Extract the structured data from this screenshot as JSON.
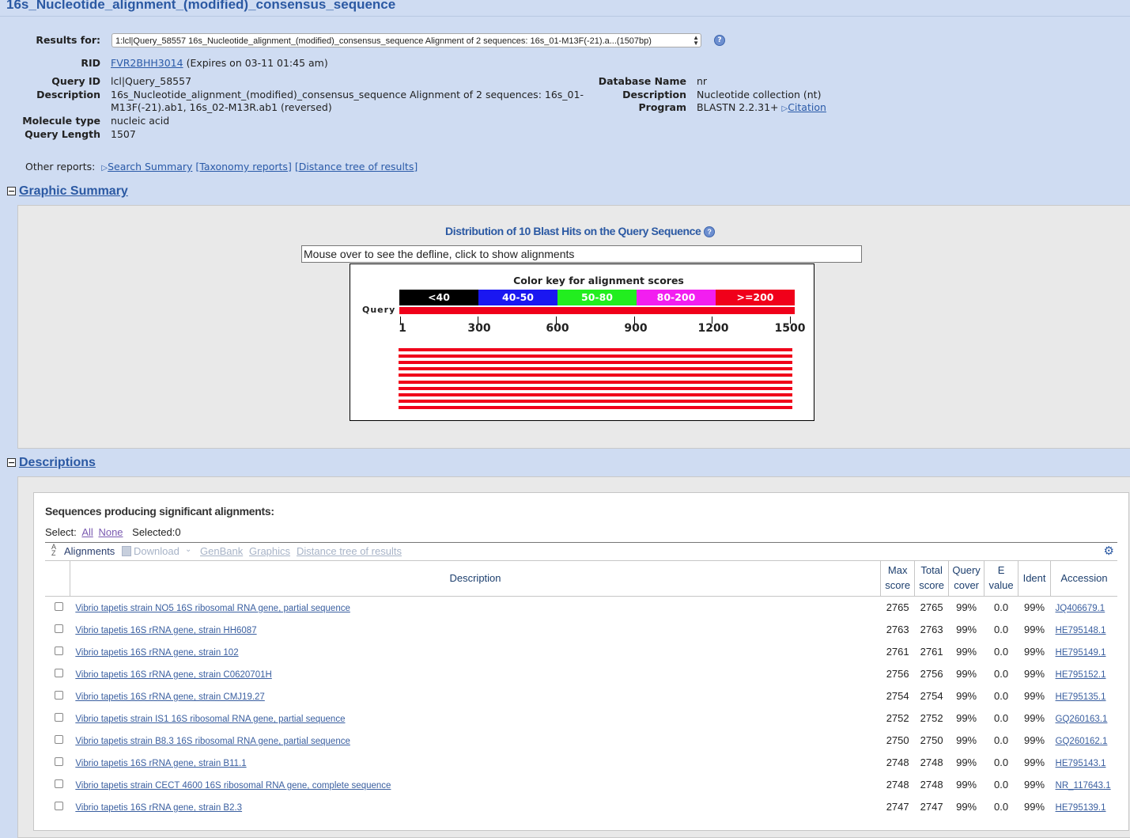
{
  "page": {
    "title": "16s_Nucleotide_alignment_(modified)_consensus_sequence"
  },
  "results_for": {
    "label": "Results for:",
    "value": "1:lcl|Query_58557 16s_Nucleotide_alignment_(modified)_consensus_sequence Alignment of 2 sequences: 16s_01-M13F(-21).a...(1507bp)"
  },
  "rid": {
    "label": "RID",
    "value": "FVR2BHH3014",
    "expires": "(Expires on 03-11 01:45 am)"
  },
  "query": {
    "id_label": "Query ID",
    "id": "lcl|Query_58557",
    "desc_label": "Description",
    "desc_line1": "16s_Nucleotide_alignment_(modified)_consensus_sequence Alignment of 2 sequences: 16s_01-",
    "desc_line2": "M13F(-21).ab1, 16s_02-M13R.ab1 (reversed)",
    "moltype_label": "Molecule type",
    "moltype": "nucleic acid",
    "length_label": "Query Length",
    "length": "1507"
  },
  "database": {
    "name_label": "Database Name",
    "name": "nr",
    "desc_label": "Description",
    "desc": "Nucleotide collection (nt)",
    "program_label": "Program",
    "program": "BLASTN 2.2.31+",
    "citation": "Citation"
  },
  "other_reports": {
    "label": "Other reports:",
    "search_summary": "Search Summary",
    "taxonomy": "[Taxonomy reports]",
    "distance_tree": "[Distance tree of results]"
  },
  "graphic_summary": {
    "heading": "Graphic Summary",
    "dist_title": "Distribution of 10 Blast Hits on the Query Sequence",
    "defline": "Mouse over to see the defline, click to show alignments",
    "color_key_title": "Color key for alignment scores",
    "query_label": "Query",
    "key": [
      {
        "label": "<40",
        "color": "#000000"
      },
      {
        "label": "40-50",
        "color": "#1a17f1"
      },
      {
        "label": "50-80",
        "color": "#22ee1f"
      },
      {
        "label": "80-200",
        "color": "#f21ef0"
      },
      {
        "label": ">=200",
        "color": "#f0001a"
      }
    ],
    "ticks": [
      "1",
      "300",
      "600",
      "900",
      "1200",
      "1500"
    ],
    "hit_count": 10
  },
  "descriptions": {
    "heading": "Descriptions",
    "panel_title": "Sequences producing significant alignments:",
    "select_label": "Select:",
    "select_all": "All",
    "select_none": "None",
    "selected": "Selected:0",
    "toolbar": {
      "alignments": "Alignments",
      "download": "Download",
      "genbank": "GenBank",
      "graphics": "Graphics",
      "distance_tree": "Distance tree of results"
    },
    "columns": {
      "description": "Description",
      "max_score_1": "Max",
      "max_score_2": "score",
      "total_score_1": "Total",
      "total_score_2": "score",
      "query_cover_1": "Query",
      "query_cover_2": "cover",
      "evalue_1": "E",
      "evalue_2": "value",
      "ident": "Ident",
      "accession": "Accession"
    },
    "rows": [
      {
        "desc": "Vibrio tapetis strain NO5 16S ribosomal RNA gene, partial sequence",
        "max": "2765",
        "total": "2765",
        "cover": "99%",
        "evalue": "0.0",
        "ident": "99%",
        "acc": "JQ406679.1"
      },
      {
        "desc": "Vibrio tapetis 16S rRNA gene, strain HH6087",
        "max": "2763",
        "total": "2763",
        "cover": "99%",
        "evalue": "0.0",
        "ident": "99%",
        "acc": "HE795148.1"
      },
      {
        "desc": "Vibrio tapetis 16S rRNA gene, strain 102",
        "max": "2761",
        "total": "2761",
        "cover": "99%",
        "evalue": "0.0",
        "ident": "99%",
        "acc": "HE795149.1"
      },
      {
        "desc": "Vibrio tapetis 16S rRNA gene, strain C0620701H",
        "max": "2756",
        "total": "2756",
        "cover": "99%",
        "evalue": "0.0",
        "ident": "99%",
        "acc": "HE795152.1"
      },
      {
        "desc": "Vibrio tapetis 16S rRNA gene, strain CMJ19.27",
        "max": "2754",
        "total": "2754",
        "cover": "99%",
        "evalue": "0.0",
        "ident": "99%",
        "acc": "HE795135.1"
      },
      {
        "desc": "Vibrio tapetis strain IS1 16S ribosomal RNA gene, partial sequence",
        "max": "2752",
        "total": "2752",
        "cover": "99%",
        "evalue": "0.0",
        "ident": "99%",
        "acc": "GQ260163.1"
      },
      {
        "desc": "Vibrio tapetis strain B8.3 16S ribosomal RNA gene, partial sequence",
        "max": "2750",
        "total": "2750",
        "cover": "99%",
        "evalue": "0.0",
        "ident": "99%",
        "acc": "GQ260162.1"
      },
      {
        "desc": "Vibrio tapetis 16S rRNA gene, strain B11.1",
        "max": "2748",
        "total": "2748",
        "cover": "99%",
        "evalue": "0.0",
        "ident": "99%",
        "acc": "HE795143.1"
      },
      {
        "desc": "Vibrio tapetis strain CECT 4600 16S ribosomal RNA gene, complete sequence",
        "max": "2748",
        "total": "2748",
        "cover": "99%",
        "evalue": "0.0",
        "ident": "99%",
        "acc": "NR_117643.1"
      },
      {
        "desc": "Vibrio tapetis 16S rRNA gene, strain B2.3",
        "max": "2747",
        "total": "2747",
        "cover": "99%",
        "evalue": "0.0",
        "ident": "99%",
        "acc": "HE795139.1"
      }
    ]
  }
}
